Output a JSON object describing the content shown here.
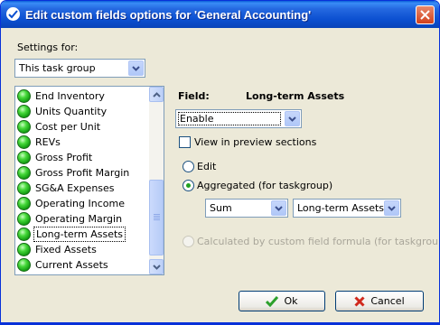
{
  "window": {
    "title": "Edit custom fields options for  'General Accounting'"
  },
  "settings": {
    "label": "Settings for:",
    "selected": "This task group"
  },
  "list": {
    "items": [
      {
        "label": "End Inventory"
      },
      {
        "label": "Units Quantity"
      },
      {
        "label": "Cost per Unit"
      },
      {
        "label": "REVs"
      },
      {
        "label": "Gross Profit"
      },
      {
        "label": "Gross Profit Margin"
      },
      {
        "label": "SG&A Expenses"
      },
      {
        "label": "Operating Income"
      },
      {
        "label": "Operating Margin"
      },
      {
        "label": "Long-term Assets"
      },
      {
        "label": "Fixed Assets"
      },
      {
        "label": "Current Assets"
      }
    ],
    "selected_label": "Long-term Assets"
  },
  "field": {
    "label": "Field:",
    "name": "Long-term Assets",
    "mode_selected": "Enable",
    "view_in_preview_label": "View in preview sections",
    "edit_label": "Edit",
    "aggregated_label": "Aggregated (for taskgroup)",
    "aggregate_function": "Sum",
    "aggregate_source": "Long-term Assets",
    "calculated_label": "Calculated by custom field formula (for taskgroup)"
  },
  "buttons": {
    "ok": "Ok",
    "cancel": "Cancel"
  },
  "colors": {
    "title_bar": "#0b4fd0",
    "dialog_bg": "#ece9d8",
    "checked_radio": "#21a121",
    "status_green": "#46d83a",
    "cancel_x": "#d0281c"
  }
}
